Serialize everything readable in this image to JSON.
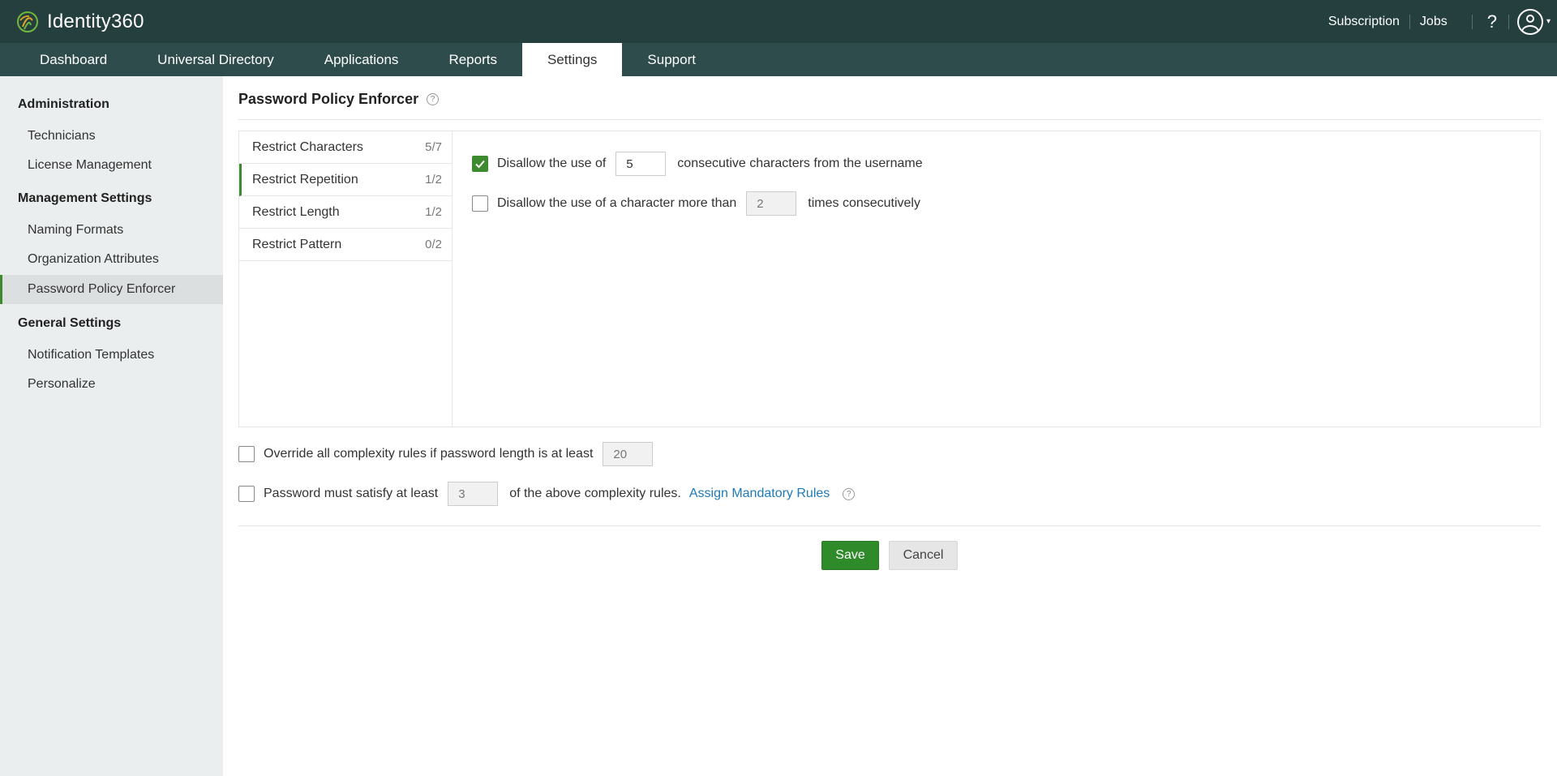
{
  "header": {
    "app_name": "Identity360",
    "links": {
      "subscription": "Subscription",
      "jobs": "Jobs"
    },
    "help_label": "?",
    "icons": {
      "logo": "fingerprint-logo-icon",
      "help": "question-icon",
      "user": "user-avatar-icon",
      "caret": "chevron-down-icon"
    }
  },
  "tabs": [
    {
      "label": "Dashboard"
    },
    {
      "label": "Universal Directory"
    },
    {
      "label": "Applications"
    },
    {
      "label": "Reports"
    },
    {
      "label": "Settings",
      "active": true
    },
    {
      "label": "Support"
    }
  ],
  "sidebar": {
    "sections": [
      {
        "title": "Administration",
        "items": [
          "Technicians",
          "License Management"
        ]
      },
      {
        "title": "Management Settings",
        "items": [
          "Naming Formats",
          "Organization Attributes",
          "Password Policy Enforcer"
        ]
      },
      {
        "title": "General Settings",
        "items": [
          "Notification Templates",
          "Personalize"
        ]
      }
    ],
    "active_item": "Password Policy Enforcer"
  },
  "page": {
    "title": "Password Policy Enforcer",
    "help_icon": "question-circle-icon"
  },
  "rules": [
    {
      "label": "Restrict Characters",
      "count": "5/7"
    },
    {
      "label": "Restrict Repetition",
      "count": "1/2",
      "active": true
    },
    {
      "label": "Restrict Length",
      "count": "1/2"
    },
    {
      "label": "Restrict Pattern",
      "count": "0/2"
    }
  ],
  "options": {
    "consecutive_username": {
      "checked": true,
      "prefix": "Disallow the use of",
      "value": "5",
      "suffix": "consecutive characters from the username"
    },
    "char_repeat": {
      "checked": false,
      "prefix": "Disallow the use of a character more than",
      "value": "2",
      "suffix": "times consecutively"
    }
  },
  "complexity": {
    "override": {
      "checked": false,
      "label": "Override all complexity rules if password length is at least",
      "value": "20"
    },
    "satisfy": {
      "checked": false,
      "prefix": "Password must satisfy at least",
      "value": "3",
      "suffix": "of the above complexity rules.",
      "link": "Assign Mandatory Rules"
    }
  },
  "buttons": {
    "save": "Save",
    "cancel": "Cancel"
  },
  "colors": {
    "header_bg": "#253f3f",
    "tab_bg": "#2f4c4d",
    "accent_green": "#3d8b2e",
    "link_blue": "#1f7ab8",
    "sidebar_bg": "#eaeeee"
  }
}
